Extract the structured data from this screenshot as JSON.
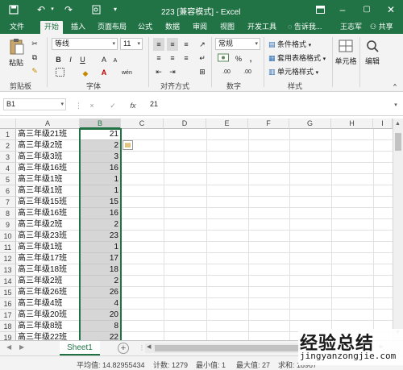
{
  "title": {
    "text": "223  [兼容模式] - Excel",
    "user": "王志军"
  },
  "tabs": [
    {
      "label": "文件"
    },
    {
      "label": "开始"
    },
    {
      "label": "插入"
    },
    {
      "label": "页面布局"
    },
    {
      "label": "公式"
    },
    {
      "label": "数据"
    },
    {
      "label": "审阅"
    },
    {
      "label": "视图"
    },
    {
      "label": "开发工具"
    },
    {
      "label": "告诉我..."
    },
    {
      "label": "共享"
    }
  ],
  "ribbon": {
    "paste": "粘贴",
    "font_name": "等线",
    "font_size": "11",
    "number_format": "常规",
    "cond_format": "条件格式",
    "table_format": "套用表格格式",
    "cell_style": "单元格样式",
    "cells": "单元格",
    "edit": "编辑",
    "groups": {
      "clipboard": "剪贴板",
      "font": "字体",
      "align": "对齐方式",
      "number": "数字",
      "style": "样式"
    },
    "bold": "B",
    "italic": "I",
    "underline": "U",
    "font_a": "A",
    "percent": "%",
    "comma": ",",
    "inc_dec": ".00",
    "a_big": "A",
    "a_small": "A",
    "wen": "wén"
  },
  "formula": {
    "namebox": "B1",
    "value": "21",
    "fx": "fx",
    "cancel": "×",
    "enter": "✓"
  },
  "columns": [
    "A",
    "B",
    "C",
    "D",
    "E",
    "F",
    "G",
    "H",
    "I"
  ],
  "rows": [
    {
      "n": "1",
      "a": "高三年级21班",
      "b": "21"
    },
    {
      "n": "2",
      "a": "高三年级2班",
      "b": "2"
    },
    {
      "n": "3",
      "a": "高三年级3班",
      "b": "3"
    },
    {
      "n": "4",
      "a": "高三年级16班",
      "b": "16"
    },
    {
      "n": "5",
      "a": "高三年级1班",
      "b": "1"
    },
    {
      "n": "6",
      "a": "高三年级1班",
      "b": "1"
    },
    {
      "n": "7",
      "a": "高三年级15班",
      "b": "15"
    },
    {
      "n": "8",
      "a": "高三年级16班",
      "b": "16"
    },
    {
      "n": "9",
      "a": "高三年级2班",
      "b": "2"
    },
    {
      "n": "10",
      "a": "高三年级23班",
      "b": "23"
    },
    {
      "n": "11",
      "a": "高三年级1班",
      "b": "1"
    },
    {
      "n": "12",
      "a": "高三年级17班",
      "b": "17"
    },
    {
      "n": "13",
      "a": "高三年级18班",
      "b": "18"
    },
    {
      "n": "14",
      "a": "高三年级2班",
      "b": "2"
    },
    {
      "n": "15",
      "a": "高三年级26班",
      "b": "26"
    },
    {
      "n": "16",
      "a": "高三年级4班",
      "b": "4"
    },
    {
      "n": "17",
      "a": "高三年级20班",
      "b": "20"
    },
    {
      "n": "18",
      "a": "高三年级8班",
      "b": "8"
    },
    {
      "n": "19",
      "a": "高三年级22班",
      "b": "22"
    }
  ],
  "sheet": {
    "tab": "Sheet1",
    "add": "+"
  },
  "status": {
    "average": "平均值: 14.82955434",
    "count": "计数: 1279",
    "min": "最小值: 1",
    "max": "最大值: 27",
    "sum": "求和: 18967"
  },
  "watermark": {
    "text": "经验总结",
    "url": "jingyanzongjie.com"
  },
  "colors": {
    "accent": "#217346",
    "selection": "#d6d6d6"
  }
}
